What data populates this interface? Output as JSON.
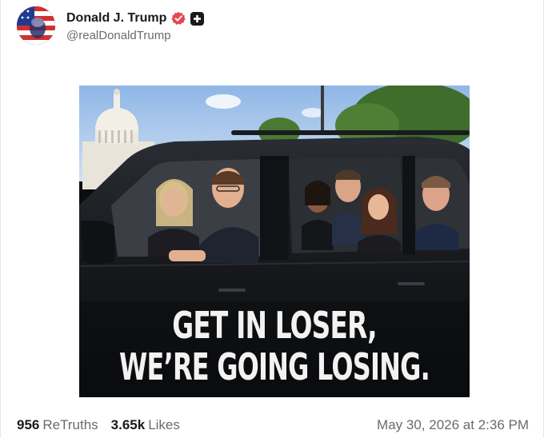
{
  "author": {
    "display_name": "Donald J. Trump",
    "handle": "@realDonaldTrump",
    "avatar_icon": "profile-avatar",
    "verified_icon": "verified-badge-icon",
    "verified_color": "#e5484d",
    "plus_icon": "plus-badge-icon"
  },
  "media": {
    "caption_line_1": "GET IN LOSER,",
    "caption_line_2": "WE’RE GOING LOSING."
  },
  "stats": {
    "retruths_count": "956",
    "retruths_label": "ReTruths",
    "likes_count": "3.65k",
    "likes_label": "Likes"
  },
  "timestamp": "May 30, 2026 at 2:36 PM",
  "colors": {
    "text_primary": "#1a1a1a",
    "text_secondary": "#6b6b6b",
    "background": "#ffffff"
  }
}
